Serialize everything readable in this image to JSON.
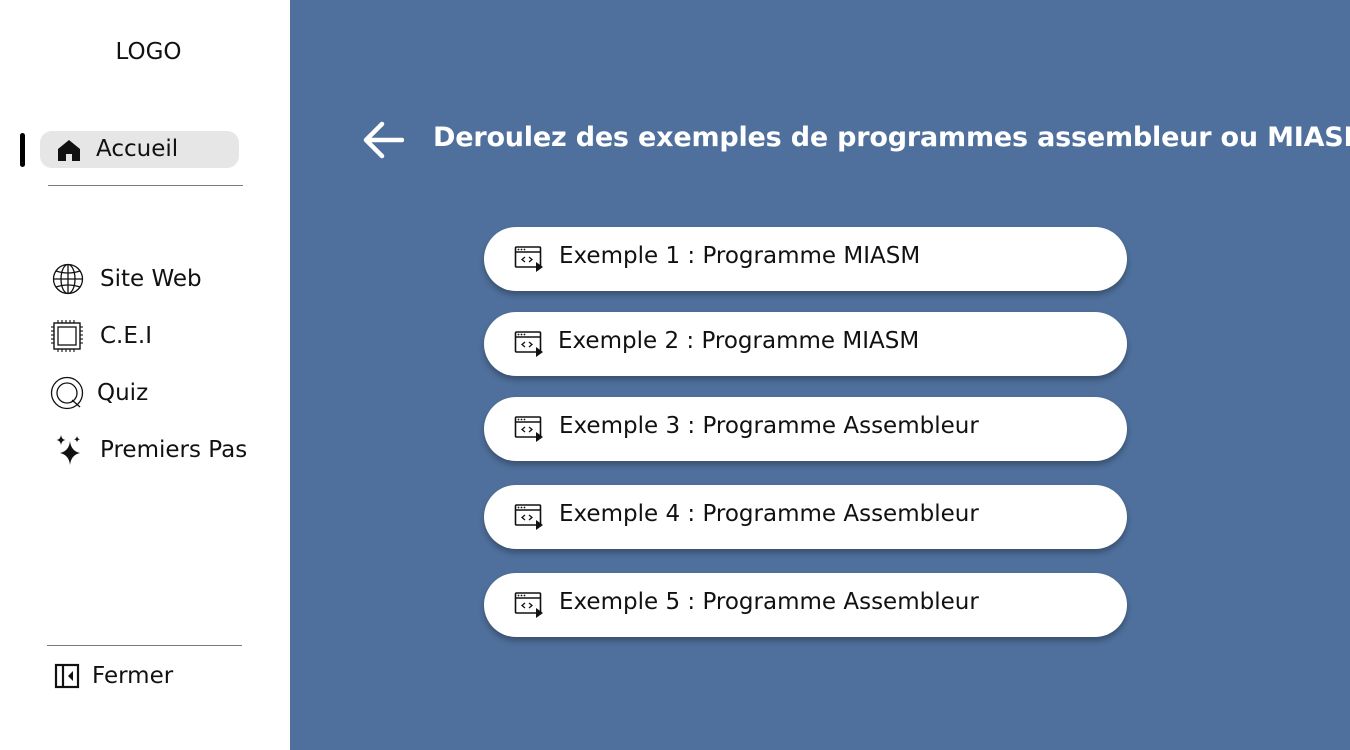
{
  "sidebar": {
    "logo": "LOGO",
    "home_label": "Accueil",
    "items": [
      {
        "label": "Site Web",
        "icon": "globe-icon"
      },
      {
        "label": "C.E.I",
        "icon": "chip-icon"
      },
      {
        "label": "Quiz",
        "icon": "quiz-icon"
      },
      {
        "label": "Premiers Pas",
        "icon": "sparkles-icon"
      }
    ],
    "close_label": "Fermer"
  },
  "main": {
    "title": "Deroulez des exemples de programmes assembleur ou MIASM",
    "examples": [
      {
        "label": "Exemple 1 : Programme MIASM"
      },
      {
        "label": "Exemple 2 : Programme MIASM"
      },
      {
        "label": "Exemple 3 : Programme Assembleur"
      },
      {
        "label": "Exemple 4 : Programme Assembleur"
      },
      {
        "label": "Exemple 5 : Programme Assembleur"
      }
    ]
  },
  "colors": {
    "main_background": "#4f709c",
    "sidebar_background": "#ffffff",
    "active_item_background": "#e6e6e6",
    "button_background": "#ffffff"
  }
}
